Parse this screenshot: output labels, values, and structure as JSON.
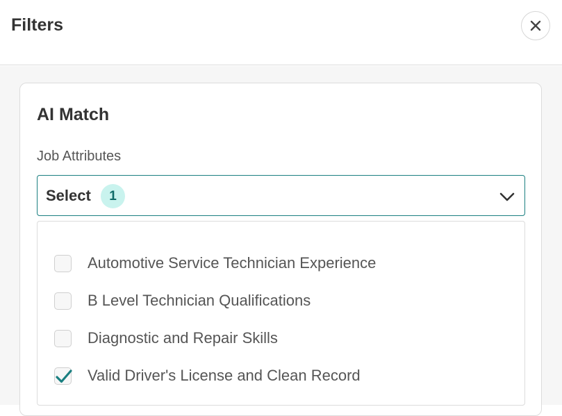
{
  "header": {
    "title": "Filters"
  },
  "card": {
    "title": "AI Match",
    "field_label": "Job Attributes",
    "select": {
      "text": "Select",
      "badge_count": "1"
    },
    "options": [
      {
        "label": "Automotive Service Technician Experience",
        "checked": false
      },
      {
        "label": "B Level Technician Qualifications",
        "checked": false
      },
      {
        "label": "Diagnostic and Repair Skills",
        "checked": false
      },
      {
        "label": "Valid Driver's License and Clean Record",
        "checked": true
      }
    ]
  },
  "colors": {
    "accent": "#1a7f80",
    "badge_bg": "#c9f3ee",
    "check": "#1a7f80"
  },
  "icons": {
    "close": "close-icon",
    "chevron": "chevron-down-icon",
    "check": "check-icon"
  }
}
